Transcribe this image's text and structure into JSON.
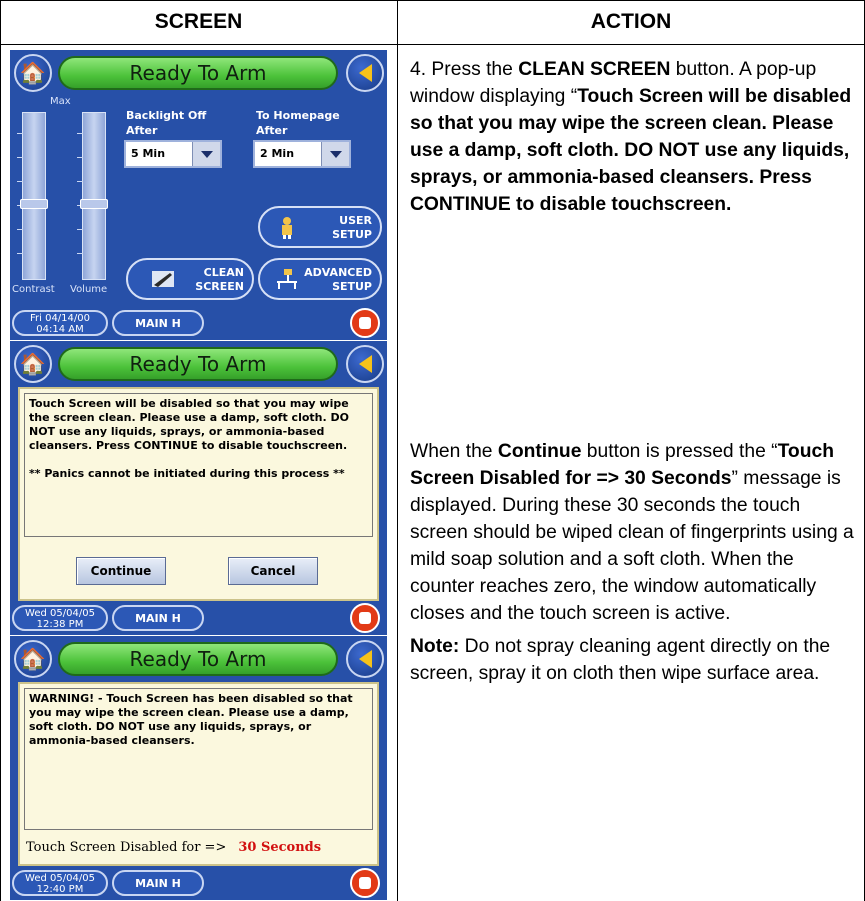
{
  "headers": {
    "screen": "SCREEN",
    "action": "ACTION"
  },
  "action1": {
    "p1_a": "4.  Press the ",
    "p1_b": "CLEAN SCREEN",
    "p1_c": " button.  A pop-up window displaying “",
    "p1_d": "Touch Screen will be disabled so that you may wipe the screen clean. Please use a damp, soft cloth. DO NOT use any liquids, sprays, or ammonia-based cleansers. Press CONTINUE to disable touchscreen."
  },
  "action2": {
    "p1_a": "When the ",
    "p1_b": "Continue",
    "p1_c": " button is pressed the “",
    "p1_d": "Touch Screen Disabled for => 30 Seconds",
    "p1_e": "” message is displayed. During these 30 seconds the touch screen should be wiped clean of fingerprints using a mild soap solution and a soft cloth.  When the counter reaches zero, the window automatically closes and the touch screen is active.",
    "note_label": "Note:",
    "note_text": " Do not spray cleaning agent directly on the screen, spray it on cloth then wipe surface area."
  },
  "title": "Ready To Arm",
  "main_label": "MAIN H",
  "panel1": {
    "max": "Max",
    "contrast": "Contrast",
    "volume": "Volume",
    "backlight_l1": "Backlight Off",
    "backlight_l2": "After",
    "homepage_l1": "To Homepage",
    "homepage_l2": "After",
    "backlight_value": "5 Min",
    "homepage_value": "2 Min",
    "user_l1": "USER",
    "user_l2": "SETUP",
    "clean_l1": "CLEAN",
    "clean_l2": "SCREEN",
    "adv_l1": "ADVANCED",
    "adv_l2": "SETUP",
    "date_l1": "Fri 04/14/00",
    "date_l2": "04:14 AM"
  },
  "panel2": {
    "message": "Touch Screen will be disabled so that you may wipe the screen clean. Please use a damp, soft cloth. DO NOT use any liquids, sprays, or ammonia-based cleansers. Press CONTINUE to disable touchscreen.",
    "panic": "** Panics cannot be initiated during this process **",
    "continue": "Continue",
    "cancel": "Cancel",
    "date_l1": "Wed 05/04/05",
    "date_l2": "12:38 PM"
  },
  "panel3": {
    "warning": "WARNING! - Touch Screen has been disabled so that you may wipe the screen clean. Please use a damp, soft cloth. DO NOT use any liquids, sprays, or ammonia-based cleansers.",
    "disabled_label": "Touch Screen Disabled for =>",
    "seconds": "30 Seconds",
    "date_l1": "Wed 05/04/05",
    "date_l2": "12:40 PM"
  }
}
